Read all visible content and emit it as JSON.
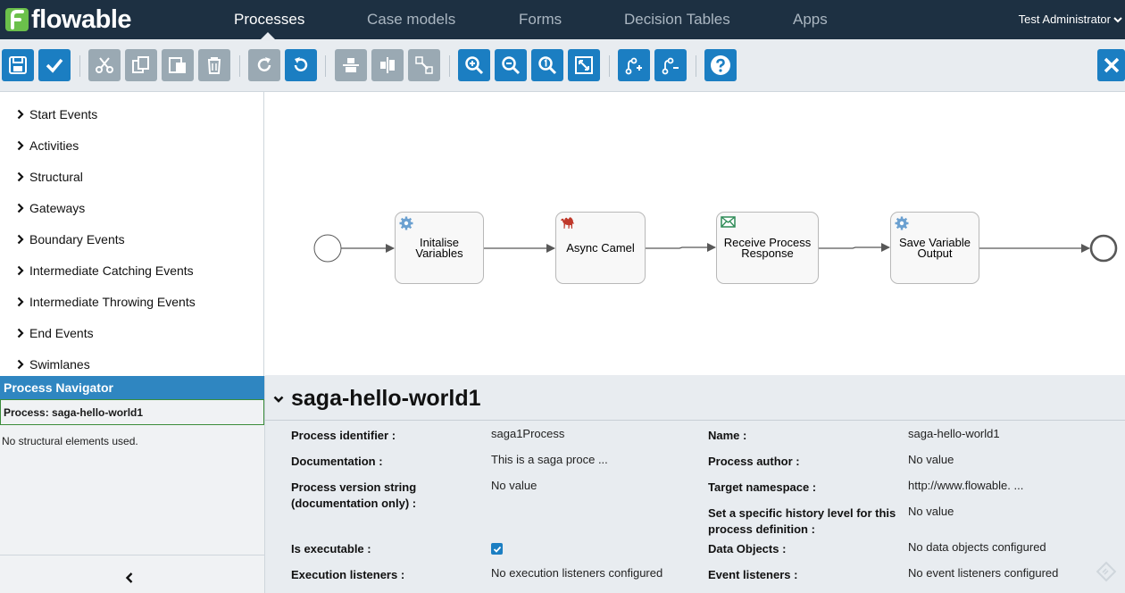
{
  "app": {
    "logo_text": "flowable",
    "brand_color": "#6bc04b",
    "nav_bg": "#1d3042",
    "accent": "#1b7ec2"
  },
  "nav": {
    "tabs": [
      {
        "label": "Processes",
        "active": true
      },
      {
        "label": "Case models",
        "active": false
      },
      {
        "label": "Forms",
        "active": false
      },
      {
        "label": "Decision Tables",
        "active": false
      },
      {
        "label": "Apps",
        "active": false
      }
    ],
    "user": "Test Administrator"
  },
  "toolbar": {
    "buttons": [
      {
        "name": "save",
        "icon": "save-icon"
      },
      {
        "name": "validate",
        "icon": "check-icon"
      },
      {
        "name": "cut",
        "icon": "cut-icon"
      },
      {
        "name": "copy",
        "icon": "copy-icon"
      },
      {
        "name": "paste",
        "icon": "paste-icon"
      },
      {
        "name": "delete",
        "icon": "trash-icon"
      },
      {
        "name": "redo",
        "icon": "redo-icon"
      },
      {
        "name": "undo",
        "icon": "undo-icon"
      },
      {
        "name": "align-horizontal",
        "icon": "align-horizontal-icon"
      },
      {
        "name": "align-vertical",
        "icon": "align-vertical-icon"
      },
      {
        "name": "same-size",
        "icon": "same-size-icon"
      },
      {
        "name": "zoom-in",
        "icon": "zoom-in-icon"
      },
      {
        "name": "zoom-out",
        "icon": "zoom-out-icon"
      },
      {
        "name": "zoom-actual",
        "icon": "zoom-actual-icon"
      },
      {
        "name": "zoom-fit",
        "icon": "zoom-fit-icon"
      },
      {
        "name": "add-bendpoint",
        "icon": "add-bendpoint-icon"
      },
      {
        "name": "remove-bendpoint",
        "icon": "remove-bendpoint-icon"
      },
      {
        "name": "help",
        "icon": "help-icon"
      },
      {
        "name": "close",
        "icon": "close-icon"
      }
    ]
  },
  "palette": {
    "groups": [
      "Start Events",
      "Activities",
      "Structural",
      "Gateways",
      "Boundary Events",
      "Intermediate Catching Events",
      "Intermediate Throwing Events",
      "End Events",
      "Swimlanes"
    ]
  },
  "navigator": {
    "header": "Process Navigator",
    "process_label": "Process: saga-hello-world1",
    "empty_text": "No structural elements used."
  },
  "diagram": {
    "tasks": [
      {
        "label": "Initalise Variables",
        "icon": "service-task-gear-icon"
      },
      {
        "label": "Async Camel",
        "icon": "camel-task-icon"
      },
      {
        "label": "Receive Process Response",
        "icon": "receive-task-envelope-icon"
      },
      {
        "label": "Save Variable Output",
        "icon": "service-task-gear-icon"
      }
    ]
  },
  "properties": {
    "title": "saga-hello-world1",
    "left": [
      {
        "label": "Process identifier :",
        "value": "saga1Process"
      },
      {
        "label": "Documentation :",
        "value": "This is a saga proce ..."
      },
      {
        "label": "Process version string (documentation only) :",
        "value": "No value"
      },
      {
        "label": "Is executable :",
        "value": "",
        "checked": true
      },
      {
        "label": "Execution listeners :",
        "value": "No execution listeners configured"
      }
    ],
    "right": [
      {
        "label": "Name :",
        "value": "saga-hello-world1"
      },
      {
        "label": "Process author :",
        "value": "No value"
      },
      {
        "label": "Target namespace :",
        "value": "http://www.flowable. ..."
      },
      {
        "label": "Set a specific history level for this process definition :",
        "value": "No value"
      },
      {
        "label": "Data Objects :",
        "value": "No data objects configured"
      },
      {
        "label": "Event listeners :",
        "value": "No event listeners configured"
      }
    ]
  }
}
